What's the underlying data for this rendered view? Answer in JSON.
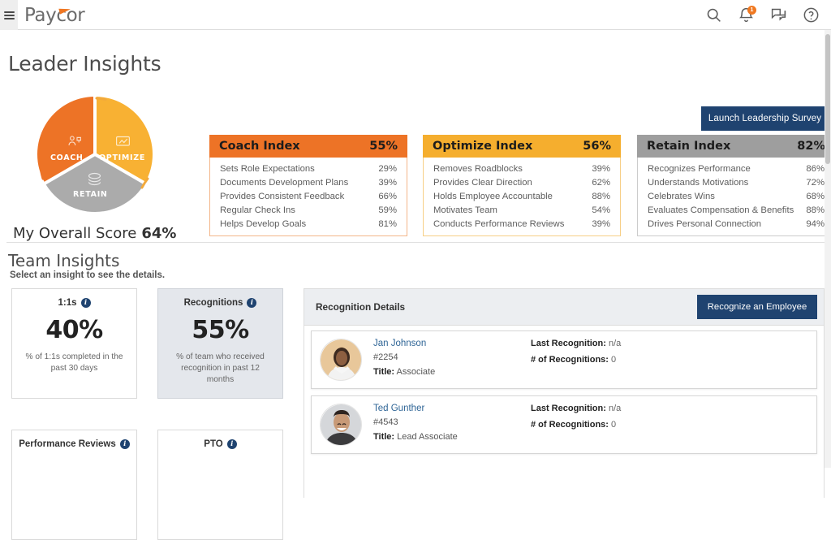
{
  "brand": {
    "name": "Paycor"
  },
  "topbar": {
    "menu_icon": "hamburger-menu-icon",
    "icons": [
      {
        "name": "search-icon",
        "label": "Search"
      },
      {
        "name": "notifications-icon",
        "label": "Notifications",
        "badge": "1"
      },
      {
        "name": "messages-icon",
        "label": "Messages"
      },
      {
        "name": "help-icon",
        "label": "Help"
      }
    ]
  },
  "page": {
    "title": "Leader Insights"
  },
  "donut": {
    "segments": [
      {
        "label": "COACH",
        "color": "#ED7326",
        "icon": "coach-icon"
      },
      {
        "label": "OPTIMIZE",
        "color": "#F8B133",
        "icon": "optimize-icon"
      },
      {
        "label": "RETAIN",
        "color": "#ABABAB",
        "icon": "retain-icon"
      }
    ],
    "overall_label": "My Overall Score",
    "overall_value": "64%"
  },
  "survey_button": {
    "label": "Launch Leadership Survey"
  },
  "index_cards": [
    {
      "title": "Coach Index",
      "score": "55%",
      "header_color": "#ED7326",
      "rows": [
        {
          "label": "Sets Role Expectations",
          "value": "29%"
        },
        {
          "label": "Documents Development Plans",
          "value": "39%"
        },
        {
          "label": "Provides Consistent Feedback",
          "value": "66%"
        },
        {
          "label": "Regular Check Ins",
          "value": "59%"
        },
        {
          "label": "Helps Develop Goals",
          "value": "81%"
        }
      ]
    },
    {
      "title": "Optimize Index",
      "score": "56%",
      "header_color": "#F5AE2E",
      "rows": [
        {
          "label": "Removes Roadblocks",
          "value": "39%"
        },
        {
          "label": "Provides Clear Direction",
          "value": "62%"
        },
        {
          "label": "Holds Employee Accountable",
          "value": "88%"
        },
        {
          "label": "Motivates Team",
          "value": "54%"
        },
        {
          "label": "Conducts Performance Reviews",
          "value": "39%"
        }
      ]
    },
    {
      "title": "Retain Index",
      "score": "82%",
      "header_color": "#9E9E9E",
      "rows": [
        {
          "label": "Recognizes Performance",
          "value": "86%"
        },
        {
          "label": "Understands Motivations",
          "value": "72%"
        },
        {
          "label": "Celebrates Wins",
          "value": "68%"
        },
        {
          "label": "Evaluates Compensation & Benefits",
          "value": "88%"
        },
        {
          "label": "Drives Personal Connection",
          "value": "94%"
        }
      ]
    }
  ],
  "team_insights": {
    "title": "Team Insights",
    "subtitle": "Select an insight to see the details.",
    "tiles": [
      {
        "title": "1:1s",
        "value": "40%",
        "desc": "% of 1:1s completed in the past 30 days",
        "selected": false
      },
      {
        "title": "Recognitions",
        "value": "55%",
        "desc": "% of team who received recognition in past 12 months",
        "selected": true
      },
      {
        "title": "Performance Reviews",
        "value": "",
        "desc": "",
        "selected": false
      },
      {
        "title": "PTO",
        "value": "",
        "desc": "",
        "selected": false
      }
    ]
  },
  "recognition_details": {
    "title": "Recognition Details",
    "button_label": "Recognize an Employee",
    "labels": {
      "title_label": "Title:",
      "last_recognition_label": "Last Recognition:",
      "num_recognitions_label": "# of Recognitions:"
    },
    "employees": [
      {
        "name": "Jan Johnson",
        "id": "#2254",
        "title": "Associate",
        "last_recognition": "n/a",
        "num_recognitions": "0"
      },
      {
        "name": "Ted Gunther",
        "id": "#4543",
        "title": "Lead Associate",
        "last_recognition": "n/a",
        "num_recognitions": "0"
      }
    ]
  },
  "colors": {
    "accent_navy": "#1F4370",
    "coach_orange": "#ED7326",
    "optimize_amber": "#F5AE2E",
    "retain_gray": "#9E9E9E"
  }
}
